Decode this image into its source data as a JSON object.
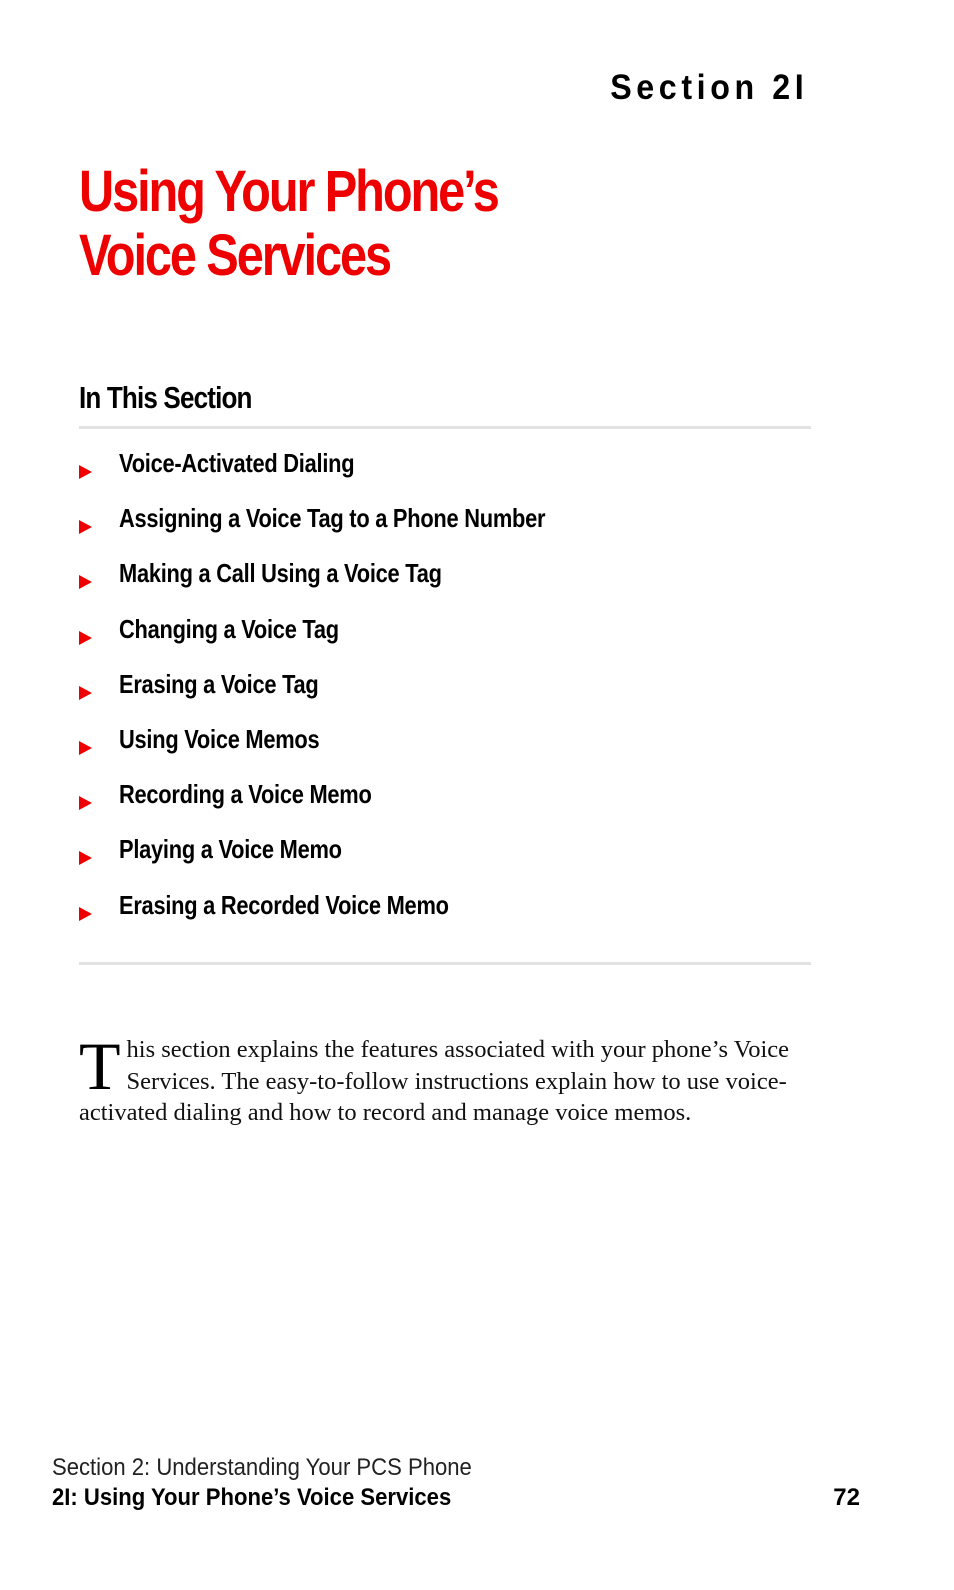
{
  "header": {
    "section_label": "Section 2I"
  },
  "title": {
    "line1": "Using Your Phone’s",
    "line2": "Voice Services",
    "color": "#ee0000"
  },
  "in_this_section": {
    "heading": "In This Section",
    "bullet_icon": "red-triangle-arrow",
    "items": [
      {
        "label": "Voice-Activated Dialing"
      },
      {
        "label": "Assigning a Voice Tag to a Phone Number"
      },
      {
        "label": "Making a Call Using a Voice Tag"
      },
      {
        "label": "Changing a Voice Tag"
      },
      {
        "label": "Erasing a Voice Tag"
      },
      {
        "label": "Using Voice Memos"
      },
      {
        "label": "Recording a Voice Memo"
      },
      {
        "label": "Playing a Voice Memo"
      },
      {
        "label": "Erasing a Recorded Voice Memo"
      }
    ]
  },
  "intro": {
    "drop_cap": "T",
    "text": "his section explains the features associated with your phone’s Voice Services. The easy-to-follow instructions explain how to use voice-activated dialing and how to record and manage voice memos."
  },
  "footer": {
    "chapter": "Section 2: Understanding Your PCS Phone",
    "section": "2I: Using Your Phone’s Voice Services",
    "page_number": "72"
  }
}
